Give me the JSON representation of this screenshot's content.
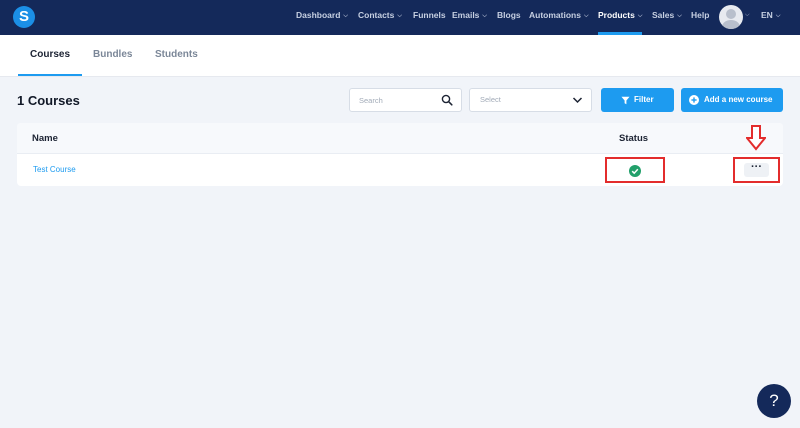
{
  "app": {
    "logo_letter": "S"
  },
  "nav": {
    "items": [
      {
        "label": "Dashboard",
        "chev": "⌵"
      },
      {
        "label": "Contacts",
        "chev": "⌵"
      },
      {
        "label": "Funnels"
      },
      {
        "label": "Emails",
        "chev": "⌵"
      },
      {
        "label": "Blogs"
      },
      {
        "label": "Automations",
        "chev": "⌵"
      },
      {
        "label": "Products",
        "chev": "⌵"
      },
      {
        "label": "Sales",
        "chev": "⌵"
      },
      {
        "label": "Help"
      }
    ],
    "language": "EN",
    "active": "Products",
    "accent": "#1d9bf0",
    "background": "#14295a"
  },
  "tabs": [
    {
      "label": "Courses"
    },
    {
      "label": "Bundles"
    },
    {
      "label": "Students"
    }
  ],
  "page": {
    "title": "1 Courses",
    "search_placeholder": "Search",
    "select_placeholder": "Select",
    "filter_label": "Filter",
    "add_label": "Add a new course"
  },
  "table": {
    "headers": {
      "name": "Name",
      "status": "Status"
    },
    "rows": [
      {
        "name": "Test Course",
        "status_icon": "check-circle-icon",
        "status_color": "#22a06b",
        "actions": "···"
      }
    ]
  },
  "annotations": {
    "highlight_color": "#e32c2c"
  },
  "help": {
    "label": "?"
  }
}
